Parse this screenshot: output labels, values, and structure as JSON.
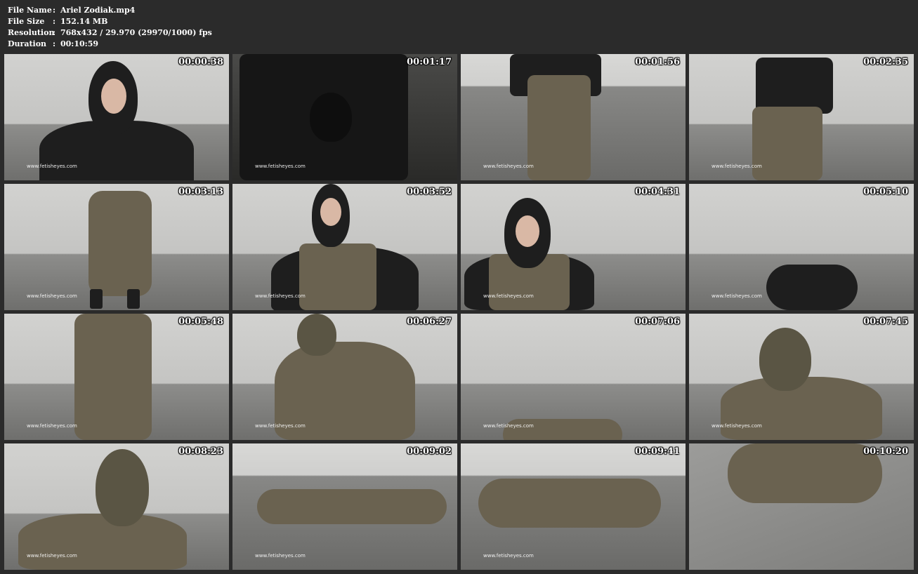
{
  "info": [
    {
      "key": "File Name",
      "value": "Ariel Zodiak.mp4"
    },
    {
      "key": "File Size",
      "value": "152.14 MB"
    },
    {
      "key": "Resolution",
      "value": "768x432 / 29.970 (29970/1000) fps"
    },
    {
      "key": "Duration",
      "value": "00:10:59"
    }
  ],
  "separator": ":",
  "watermark": "www.fetisheyes.com",
  "thumbnails": [
    {
      "time": "00:00:38"
    },
    {
      "time": "00:01:17"
    },
    {
      "time": "00:01:56"
    },
    {
      "time": "00:02:35"
    },
    {
      "time": "00:03:13"
    },
    {
      "time": "00:03:52"
    },
    {
      "time": "00:04:31"
    },
    {
      "time": "00:05:10"
    },
    {
      "time": "00:05:48"
    },
    {
      "time": "00:06:27"
    },
    {
      "time": "00:07:06"
    },
    {
      "time": "00:07:45"
    },
    {
      "time": "00:08:23"
    },
    {
      "time": "00:09:02"
    },
    {
      "time": "00:09:41"
    },
    {
      "time": "00:10:20"
    }
  ]
}
